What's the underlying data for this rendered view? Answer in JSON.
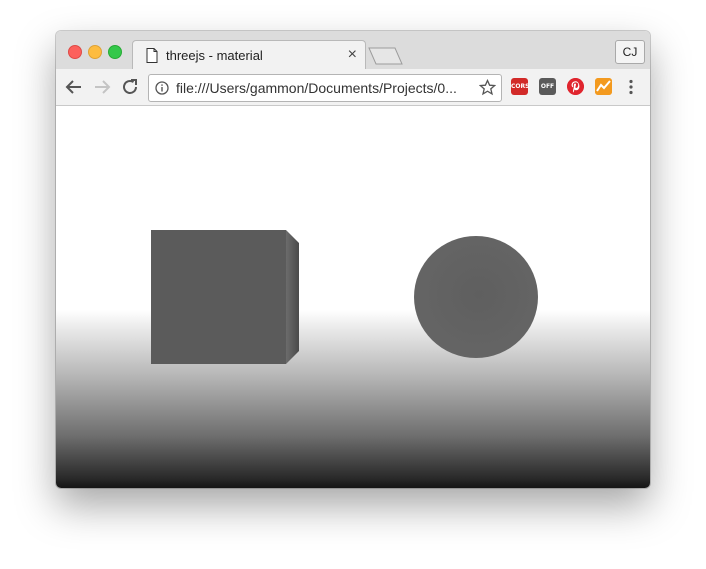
{
  "browser": {
    "tab": {
      "title": "threejs - material",
      "icon": "document-icon",
      "close_label": "×"
    },
    "profile_button": "CJ",
    "toolbar": {
      "url": "file:///Users/gammon/Documents/Projects/0...",
      "extensions": [
        {
          "name": "cors-extension",
          "label": "CORS",
          "color": "#d22a28"
        },
        {
          "name": "off-extension",
          "label": "OFF",
          "color": "#5a5a5a"
        },
        {
          "name": "pinterest-extension",
          "label": "",
          "color": "#e0252e"
        },
        {
          "name": "chart-extension",
          "label": "",
          "color": "#f39a1f"
        }
      ]
    }
  },
  "scene": {
    "background": "vertical white-to-black gradient",
    "objects": [
      {
        "name": "cube",
        "color": "#5b5b5b"
      },
      {
        "name": "sphere",
        "color": "#5e5e5e"
      }
    ]
  }
}
